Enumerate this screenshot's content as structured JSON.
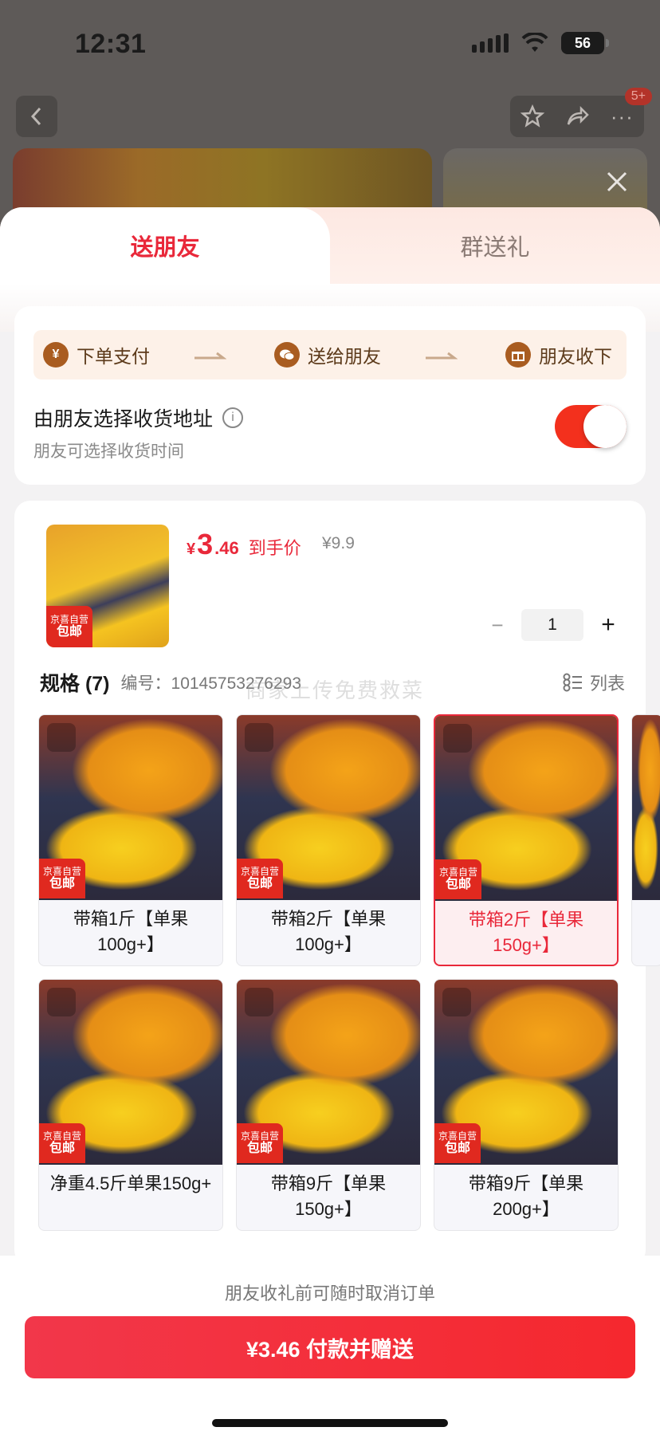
{
  "status_bar": {
    "time": "12:31",
    "battery": "56"
  },
  "background_page": {
    "cart_badge": "5+"
  },
  "sheet": {
    "tabs": [
      {
        "label": "送朋友",
        "active": true
      },
      {
        "label": "群送礼",
        "active": false
      }
    ],
    "steps": [
      {
        "icon": "yen-icon",
        "label": "下单支付"
      },
      {
        "icon": "wechat-icon",
        "label": "送给朋友"
      },
      {
        "icon": "gift-icon",
        "label": "朋友收下"
      }
    ],
    "address": {
      "title": "由朋友选择收货地址",
      "subtitle": "朋友可选择收货时间",
      "toggle_on": true
    },
    "product": {
      "tag_top": "京喜自营",
      "tag_bottom": "包邮",
      "price_symbol": "¥",
      "price_int": "3",
      "price_dec": ".46",
      "price_label": "到手价",
      "original_price": "¥9.9",
      "quantity": "1"
    },
    "specs": {
      "title": "规格 (7)",
      "number_label": "编号：10145753276293",
      "list_label": "列表",
      "watermark": "商家上传免费救菜",
      "items": [
        {
          "label": "带箱1斤【单果100g+】",
          "selected": false
        },
        {
          "label": "带箱2斤【单果100g+】",
          "selected": false
        },
        {
          "label": "带箱2斤【单果150g+】",
          "selected": true
        },
        {
          "label": "净重4.5斤单果150g+",
          "selected": false
        },
        {
          "label": "带箱9斤【单果150g+】",
          "selected": false
        },
        {
          "label": "带箱9斤【单果200g+】",
          "selected": false
        }
      ]
    }
  },
  "footer": {
    "note": "朋友收礼前可随时取消订单",
    "pay_button": "¥3.46 付款并赠送"
  },
  "colors": {
    "accent": "#e9283a",
    "toggle": "#f3301d",
    "step_icon": "#a95c20"
  }
}
